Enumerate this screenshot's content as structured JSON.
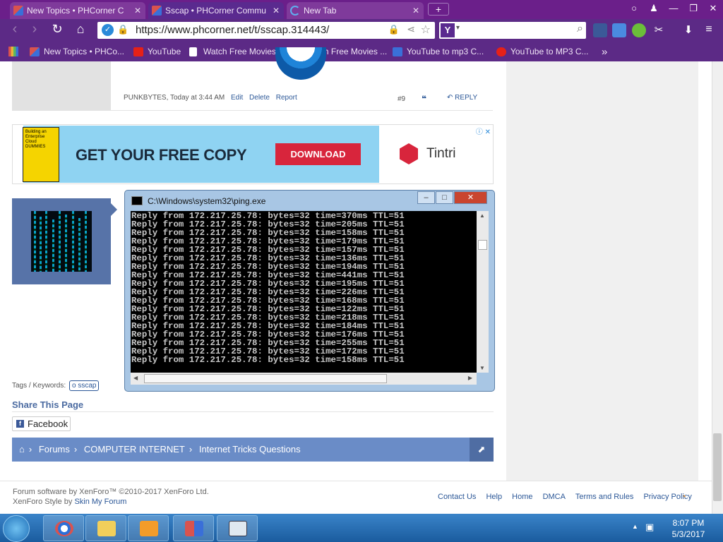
{
  "browser": {
    "tabs": [
      {
        "title": "New Topics • PHCorner C"
      },
      {
        "title": "Sscap • PHCorner Commu"
      },
      {
        "title": "New Tab"
      }
    ],
    "url": "https://www.phcorner.net/t/sscap.314443/",
    "search_engine_icon": "Y",
    "bookmarks": [
      {
        "label": "New Topics • PHCo..."
      },
      {
        "label": "YouTube"
      },
      {
        "label": "Watch Free Movies ..."
      },
      {
        "label": "Watch Free Movies ..."
      },
      {
        "label": "YouTube to mp3 C..."
      },
      {
        "label": "YouTube to MP3 C..."
      }
    ],
    "more_bookmarks": "»"
  },
  "post": {
    "author": "PUNKBYTES",
    "time": ", Today at 3:44 AM",
    "actions": [
      "Edit",
      "Delete",
      "Report"
    ],
    "number": "#9",
    "reply_label": "REPLY"
  },
  "ad": {
    "book_text": "Building an Enterprise Cloud DUMMIES",
    "headline": "GET YOUR FREE COPY",
    "button": "DOWNLOAD",
    "brand": "Tintri"
  },
  "cmd": {
    "title": "C:\\Windows\\system32\\ping.exe",
    "lines": [
      "Reply from 172.217.25.78: bytes=32 time=370ms TTL=51",
      "Reply from 172.217.25.78: bytes=32 time=205ms TTL=51",
      "Reply from 172.217.25.78: bytes=32 time=158ms TTL=51",
      "Reply from 172.217.25.78: bytes=32 time=179ms TTL=51",
      "Reply from 172.217.25.78: bytes=32 time=157ms TTL=51",
      "Reply from 172.217.25.78: bytes=32 time=136ms TTL=51",
      "Reply from 172.217.25.78: bytes=32 time=194ms TTL=51",
      "Reply from 172.217.25.78: bytes=32 time=441ms TTL=51",
      "Reply from 172.217.25.78: bytes=32 time=195ms TTL=51",
      "Reply from 172.217.25.78: bytes=32 time=226ms TTL=51",
      "Reply from 172.217.25.78: bytes=32 time=168ms TTL=51",
      "Reply from 172.217.25.78: bytes=32 time=122ms TTL=51",
      "Reply from 172.217.25.78: bytes=32 time=218ms TTL=51",
      "Reply from 172.217.25.78: bytes=32 time=184ms TTL=51",
      "Reply from 172.217.25.78: bytes=32 time=176ms TTL=51",
      "Reply from 172.217.25.78: bytes=32 time=255ms TTL=51",
      "Reply from 172.217.25.78: bytes=32 time=172ms TTL=51",
      "Reply from 172.217.25.78: bytes=32 time=158ms TTL=51"
    ]
  },
  "tags": {
    "label": "Tags / Keywords:",
    "items": [
      "o sscap"
    ]
  },
  "share": {
    "title": "Share This Page",
    "facebook": "Facebook"
  },
  "breadcrumb": [
    "Forums",
    "COMPUTER INTERNET",
    "Internet Tricks Questions"
  ],
  "footer": {
    "line1": "Forum software by XenForo™ ©2010-2017 XenForo Ltd.",
    "line2_prefix": "XenForo Style by ",
    "line2_link": "Skin My Forum",
    "links": [
      "Contact Us",
      "Help",
      "Home",
      "DMCA",
      "Terms and Rules",
      "Privacy Policy"
    ]
  },
  "taskbar": {
    "time": "8:07 PM",
    "date": "5/3/2017"
  },
  "colors": {
    "browser_theme": "#5c2a86",
    "breadcrumb": "#6a8cc7",
    "link": "#2b5797",
    "ad_button": "#d8253c"
  }
}
